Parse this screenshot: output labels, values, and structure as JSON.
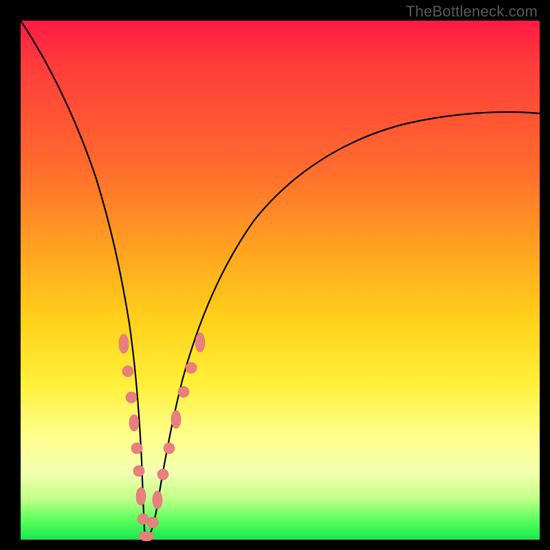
{
  "watermark": "TheBottleneck.com",
  "chart_data": {
    "type": "line",
    "title": "",
    "xlabel": "",
    "ylabel": "",
    "xlim": [
      0,
      100
    ],
    "ylim": [
      0,
      100
    ],
    "grid": false,
    "legend": false,
    "background_gradient": {
      "orientation": "vertical",
      "stops": [
        {
          "pos": 0,
          "color": "#ff1a44",
          "meaning": "severe-bottleneck"
        },
        {
          "pos": 50,
          "color": "#ffc21f",
          "meaning": "moderate"
        },
        {
          "pos": 80,
          "color": "#fff27a",
          "meaning": "minor"
        },
        {
          "pos": 100,
          "color": "#17e84d",
          "meaning": "no-bottleneck"
        }
      ]
    },
    "series": [
      {
        "name": "bottleneck-curve",
        "x": [
          0,
          3,
          6,
          9,
          12,
          14,
          16,
          18,
          19,
          20,
          21,
          22,
          23,
          24,
          26,
          28,
          30,
          33,
          37,
          42,
          48,
          55,
          63,
          72,
          82,
          92,
          100
        ],
        "y": [
          100,
          92,
          83,
          73,
          62,
          53,
          44,
          34,
          27,
          20,
          13,
          6,
          2,
          0,
          2,
          8,
          15,
          24,
          34,
          44,
          54,
          62,
          69,
          74,
          78,
          80,
          81
        ]
      }
    ],
    "markers": {
      "name": "highlighted-points",
      "color": "#e98080",
      "points": [
        {
          "x": 16.5,
          "y": 41
        },
        {
          "x": 17.8,
          "y": 34
        },
        {
          "x": 18.6,
          "y": 28
        },
        {
          "x": 19.3,
          "y": 24
        },
        {
          "x": 20.1,
          "y": 18
        },
        {
          "x": 20.8,
          "y": 13
        },
        {
          "x": 21.6,
          "y": 8
        },
        {
          "x": 22.4,
          "y": 4
        },
        {
          "x": 23.3,
          "y": 1
        },
        {
          "x": 24.2,
          "y": 0
        },
        {
          "x": 25.2,
          "y": 2
        },
        {
          "x": 26.3,
          "y": 6
        },
        {
          "x": 27.6,
          "y": 12
        },
        {
          "x": 28.8,
          "y": 18
        },
        {
          "x": 30.2,
          "y": 24
        },
        {
          "x": 31.4,
          "y": 29
        },
        {
          "x": 33.0,
          "y": 35
        },
        {
          "x": 34.4,
          "y": 40
        }
      ]
    },
    "notes": "V-shaped bottleneck curve; y is bottleneck severity percentage (0 at valley ≈ x 24); no axis ticks or numeric labels are rendered in the source image, values are read from curve geometry."
  }
}
